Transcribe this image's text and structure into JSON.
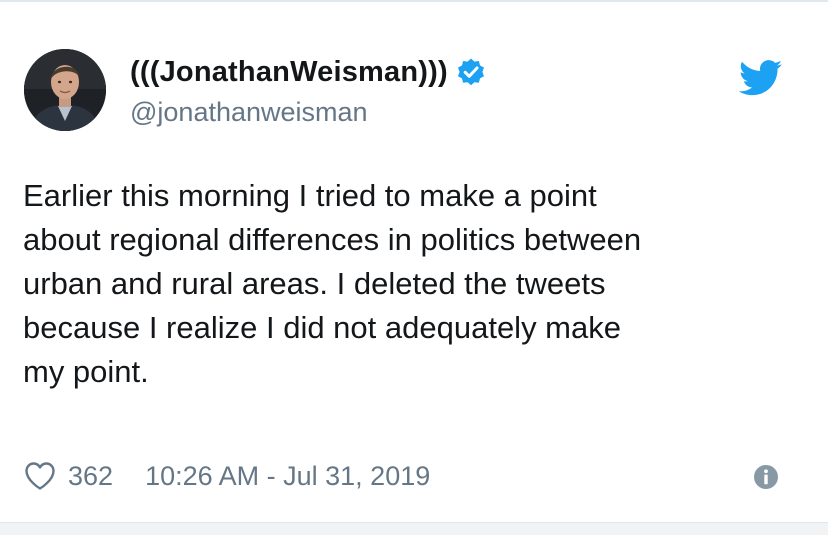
{
  "tweet": {
    "display_name": "(((JonathanWeisman)))",
    "handle": "@jonathanweisman",
    "text_lines": [
      "Earlier this morning I tried to make a point",
      "about regional differences in politics between",
      "urban and rural areas. I deleted the tweets",
      "because I realize I did not adequately make",
      "my point."
    ],
    "like_count": "362",
    "timestamp": "10:26 AM - Jul 31, 2019"
  },
  "icons": {
    "avatar": "avatar",
    "verified": "verified-badge-icon",
    "brand": "twitter-bird-icon",
    "like": "heart-icon",
    "info": "info-icon"
  },
  "colors": {
    "accent": "#1da1f2",
    "text": "#14171a",
    "muted": "#657786"
  }
}
